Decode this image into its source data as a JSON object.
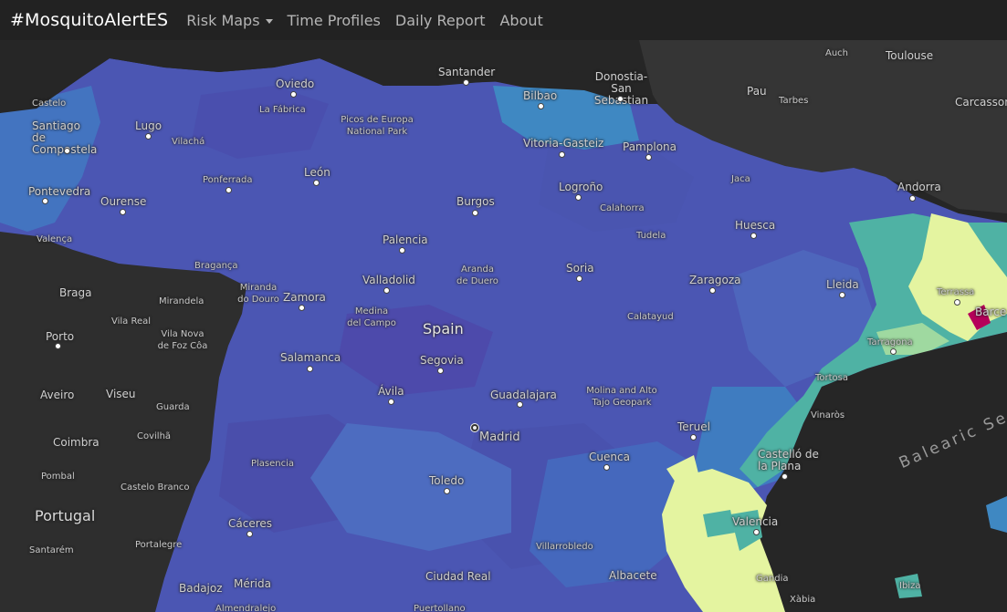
{
  "navbar": {
    "brand": "#MosquitoAlertES",
    "items": [
      {
        "label": "Risk Maps",
        "has_dropdown": true
      },
      {
        "label": "Time Profiles"
      },
      {
        "label": "Daily Report"
      },
      {
        "label": "About"
      }
    ]
  },
  "map": {
    "country_label": "Spain",
    "neighbor_country": "Portugal",
    "sea_label": "Balearic Sea",
    "capital": "Madrid",
    "colors": {
      "ocean": "#262626",
      "land_outside": "#333333",
      "risk_low": "#4b5bb5",
      "risk_mid": "#3f87c0",
      "risk_teal": "#4fb6a4",
      "risk_high": "#e6f59a",
      "risk_peak": "#b5005a"
    },
    "cities": [
      {
        "name": "Santander"
      },
      {
        "name": "Oviedo"
      },
      {
        "name": "La Fábrica"
      },
      {
        "name": "Picos de Europa National Park"
      },
      {
        "name": "Bilbao"
      },
      {
        "name": "Donostia-San Sebastian"
      },
      {
        "name": "Vitoria-Gasteiz"
      },
      {
        "name": "Pamplona"
      },
      {
        "name": "Santiago de Compostela"
      },
      {
        "name": "Lugo"
      },
      {
        "name": "Vilachá"
      },
      {
        "name": "Ponferrada"
      },
      {
        "name": "León"
      },
      {
        "name": "Pontevedra"
      },
      {
        "name": "Ourense"
      },
      {
        "name": "Valença"
      },
      {
        "name": "Burgos"
      },
      {
        "name": "Logroño"
      },
      {
        "name": "Calahorra"
      },
      {
        "name": "Jaca"
      },
      {
        "name": "Huesca"
      },
      {
        "name": "Tudela"
      },
      {
        "name": "Palencia"
      },
      {
        "name": "Bragança"
      },
      {
        "name": "Braga"
      },
      {
        "name": "Mirandela"
      },
      {
        "name": "Vila Real"
      },
      {
        "name": "Miranda do Douro"
      },
      {
        "name": "Zamora"
      },
      {
        "name": "Valladolid"
      },
      {
        "name": "Aranda de Duero"
      },
      {
        "name": "Soria"
      },
      {
        "name": "Zaragoza"
      },
      {
        "name": "Lleida"
      },
      {
        "name": "Andorra"
      },
      {
        "name": "Porto"
      },
      {
        "name": "Vila Nova de Foz Côa"
      },
      {
        "name": "Medina del Campo"
      },
      {
        "name": "Calatayud"
      },
      {
        "name": "Terrassa"
      },
      {
        "name": "Barce"
      },
      {
        "name": "Tarragona"
      },
      {
        "name": "Salamanca"
      },
      {
        "name": "Segovia"
      },
      {
        "name": "Aveiro"
      },
      {
        "name": "Viseu"
      },
      {
        "name": "Ávila"
      },
      {
        "name": "Guadalajara"
      },
      {
        "name": "Molina and Alto Tajo Geopark"
      },
      {
        "name": "Tortosa"
      },
      {
        "name": "Guarda"
      },
      {
        "name": "Covilhã"
      },
      {
        "name": "Vinaròs"
      },
      {
        "name": "Coimbra"
      },
      {
        "name": "Teruel"
      },
      {
        "name": "Castelló de la Plana"
      },
      {
        "name": "Pombal"
      },
      {
        "name": "Castelo Branco"
      },
      {
        "name": "Plasencia"
      },
      {
        "name": "Toledo"
      },
      {
        "name": "Cuenca"
      },
      {
        "name": "Cáceres"
      },
      {
        "name": "Valencia"
      },
      {
        "name": "Santarém"
      },
      {
        "name": "Portalegre"
      },
      {
        "name": "Villarrobledo"
      },
      {
        "name": "Ciudad Real"
      },
      {
        "name": "Albacete"
      },
      {
        "name": "Gandia"
      },
      {
        "name": "Badajoz"
      },
      {
        "name": "Mérida"
      },
      {
        "name": "Xàbia"
      },
      {
        "name": "Ibiza"
      },
      {
        "name": "Auch"
      },
      {
        "name": "Toulouse"
      },
      {
        "name": "Pau"
      },
      {
        "name": "Tarbes"
      },
      {
        "name": "Carcasson"
      },
      {
        "name": "Castelo"
      },
      {
        "name": "Almendralejo"
      },
      {
        "name": "Puertollano"
      }
    ]
  }
}
